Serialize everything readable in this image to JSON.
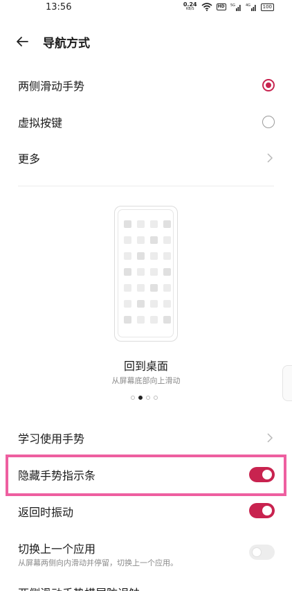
{
  "status_bar": {
    "time": "13:56",
    "net_speed": "0.24",
    "net_unit": "KB/S",
    "hd_badge": "HD",
    "signal1": "5G",
    "signal2": "4G",
    "battery": "100"
  },
  "header": {
    "title": "导航方式"
  },
  "nav_options": [
    {
      "label": "两侧滑动手势",
      "selected": true
    },
    {
      "label": "虚拟按键",
      "selected": false
    },
    {
      "label": "更多"
    }
  ],
  "demo": {
    "title": "回到桌面",
    "subtitle": "从屏幕底部向上滑动",
    "page_count": 4,
    "active_page": 2
  },
  "settings": {
    "learn_gestures": "学习使用手势",
    "hide_indicator": {
      "label": "隐藏手势指示条",
      "on": true
    },
    "back_vibrate": {
      "label": "返回时振动",
      "on": true
    },
    "switch_prev_app": {
      "label": "切换上一个应用",
      "sub": "从屏幕两侧向内滑动并停留，切换上一个应用。",
      "on": false
    },
    "cut_off_row": "两侧滑动手势横屏防误触"
  },
  "colors": {
    "accent": "#c8234f",
    "highlight": "#ee5fa0"
  }
}
